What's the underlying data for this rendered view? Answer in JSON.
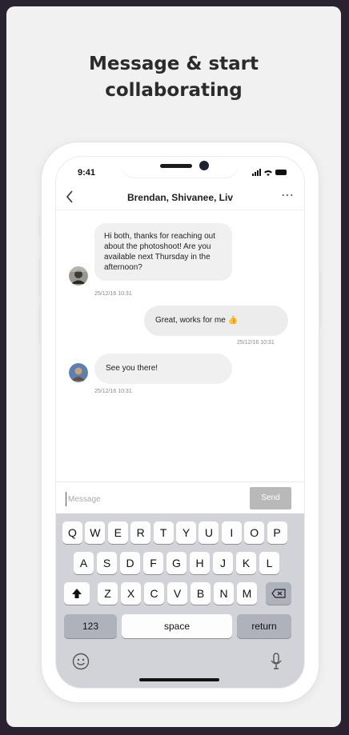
{
  "headline": "Message & start\ncollaborating",
  "status_bar": {
    "time": "9:41"
  },
  "chat": {
    "title": "Brendan, Shivanee, Liv",
    "back_icon": "chevron-left-icon",
    "more_icon": "more-dots-icon",
    "messages": [
      {
        "direction": "incoming",
        "text": "Hi both, thanks for reaching out about the photoshoot! Are you available next Thursday in the afternoon?",
        "timestamp": "25/12/16 10:31"
      },
      {
        "direction": "outgoing",
        "text": "Great, works for me 👍",
        "timestamp": "25/12/16 10:31"
      },
      {
        "direction": "incoming",
        "text": "See you there!",
        "timestamp": "25/12/16 10:31"
      }
    ]
  },
  "composer": {
    "placeholder": "Message",
    "value": "",
    "send_label": "Send"
  },
  "keyboard": {
    "row1": [
      "Q",
      "W",
      "E",
      "R",
      "T",
      "Y",
      "U",
      "I",
      "O",
      "P"
    ],
    "row2": [
      "A",
      "S",
      "D",
      "F",
      "G",
      "H",
      "J",
      "K",
      "L"
    ],
    "row3": [
      "Z",
      "X",
      "C",
      "V",
      "B",
      "N",
      "M"
    ],
    "numbers_label": "123",
    "space_label": "space",
    "return_label": "return",
    "shift_icon": "shift-icon",
    "delete_icon": "backspace-icon",
    "emoji_icon": "emoji-icon",
    "mic_icon": "microphone-icon"
  },
  "colors": {
    "send_button": "#b9b9b9",
    "keyboard_bg": "#d1d3d8",
    "bubble": "#f0f0f0"
  }
}
